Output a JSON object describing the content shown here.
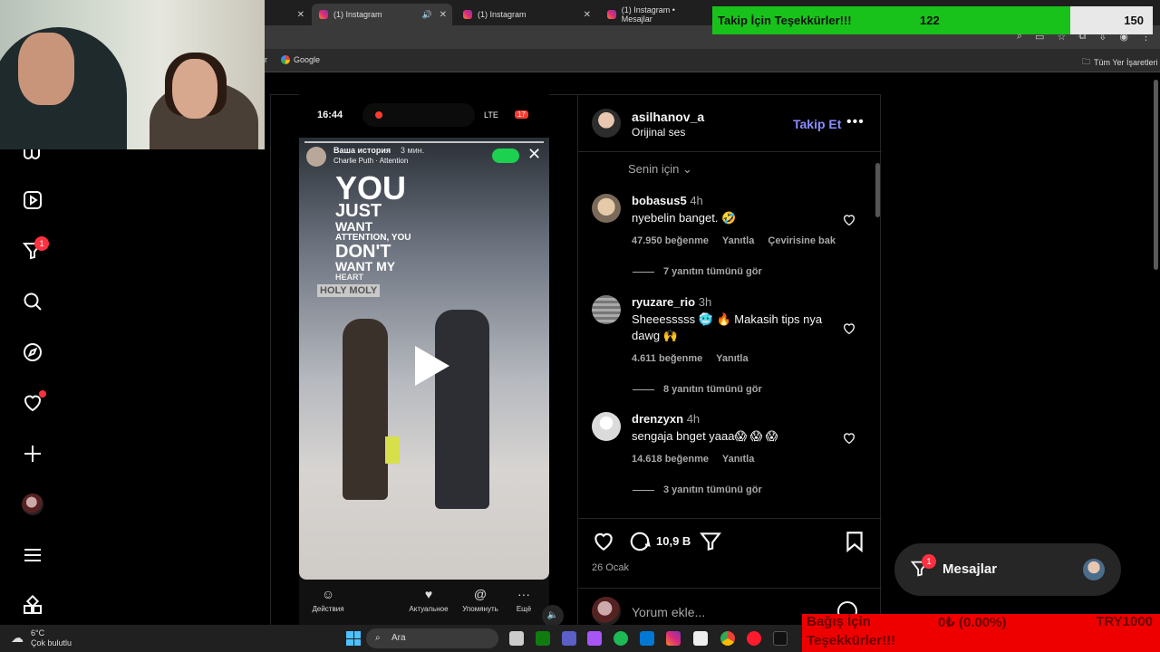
{
  "browser": {
    "tabs": [
      {
        "label": "(1) Instagram",
        "active": true
      },
      {
        "label": "(1) Instagram",
        "active": false
      },
      {
        "label": "(1) Instagram • Mesajlar",
        "active": false
      }
    ],
    "bookmarks": {
      "google": "Google",
      "partial": "ir",
      "all_bookmarks": "Tüm Yer İşaretleri"
    }
  },
  "overlays": {
    "follow_goal": {
      "label": "Takip İçin Teşekkürler!!!",
      "current": "122",
      "target": "150",
      "progress": 0.8133
    },
    "donation": {
      "line1": "Bağış İçin",
      "line2": "Teşekkürler!!!",
      "amount": "0₺ (0.00%)",
      "goal": "TRY1000"
    }
  },
  "nav": {
    "icons": [
      "threads-icon",
      "reels-icon",
      "filter-icon",
      "search-icon",
      "explore-icon",
      "notifications-icon",
      "create-icon",
      "profile-avatar",
      "menu-icon",
      "more-icon"
    ],
    "filter_badge": "1"
  },
  "video": {
    "status_time": "16:44",
    "network": "LTE",
    "battery": "17",
    "story_title": "Ваша история",
    "story_time": "3 мин.",
    "song": "Charlie Puth · Attention",
    "text_lines": [
      "YOU",
      "JUST",
      "WANT",
      "ATTENTION, YOU",
      "DON'T",
      "WANT MY",
      "HEART"
    ],
    "store_sign": "HOLY MOLY",
    "bottom_actions": [
      "Действия",
      "Актуальное",
      "Упомянуть",
      "Ещё"
    ]
  },
  "post": {
    "username": "asilhanov_a",
    "audio": "Orijinal ses",
    "follow": "Takip Et",
    "more": "•••",
    "filter": "Senin için",
    "comments": [
      {
        "user": "bobasus5",
        "time": "4h",
        "text": "nyebelin banget. 🤣",
        "likes": "47.950 beğenme",
        "reply": "Yanıtla",
        "translate": "Çevirisine bak",
        "replies": "7 yanıtın tümünü gör"
      },
      {
        "user": "ryuzare_rio",
        "time": "3h",
        "text": "Sheeesssss 🥶 🔥 Makasih tips nya dawg 🙌",
        "likes": "4.611 beğenme",
        "reply": "Yanıtla",
        "translate": "",
        "replies": "8 yanıtın tümünü gör"
      },
      {
        "user": "drenzyxn",
        "time": "4h",
        "text": "sengaja bnget yaaa😱 😱 😱",
        "likes": "14.618 beğenme",
        "reply": "Yanıtla",
        "translate": "",
        "replies": "3 yanıtın tümünü gör"
      }
    ],
    "comment_count": "10,9 B",
    "date": "26 Ocak",
    "add_comment_placeholder": "Yorum ekle..."
  },
  "messages": {
    "label": "Mesajlar",
    "badge": "1"
  },
  "taskbar": {
    "temp": "6°C",
    "weather": "Çok bulutlu",
    "search": "Ara"
  }
}
